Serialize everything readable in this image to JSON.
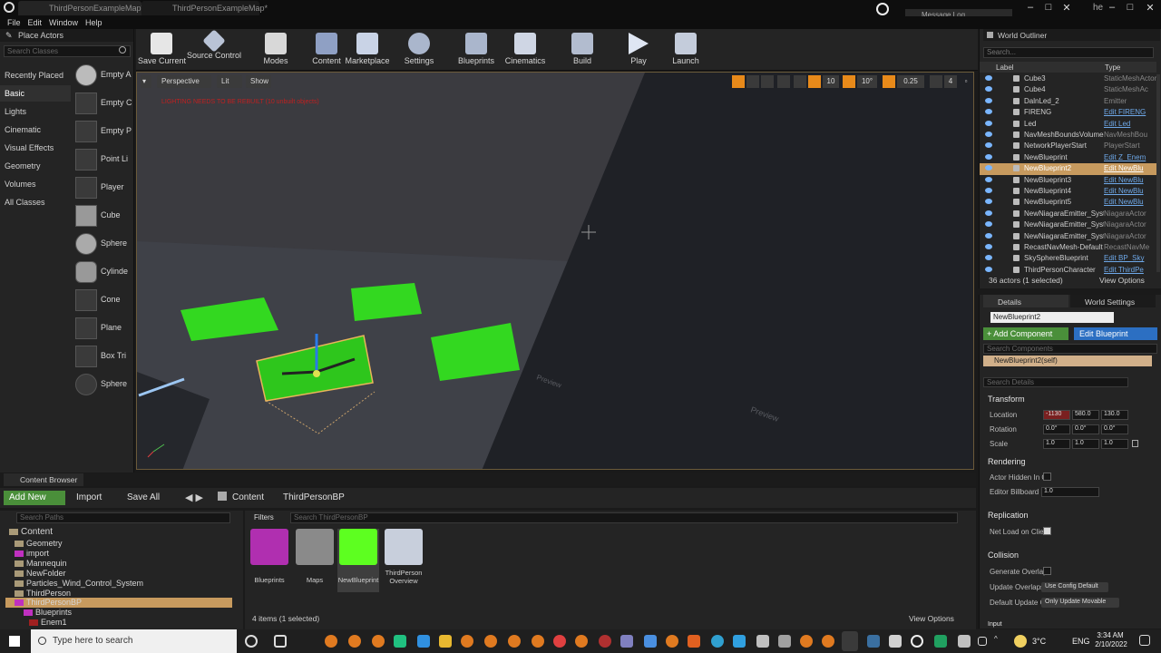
{
  "window": {
    "tabs": [
      "ThirdPersonExampleMap*",
      "ThirdPersonExampleMap*"
    ],
    "message_log": "Message Log",
    "user_initial": "he"
  },
  "menu": [
    "File",
    "Edit",
    "Window",
    "Help"
  ],
  "place_actors": {
    "title": "Place Actors",
    "search_placeholder": "Search Classes",
    "categories": [
      "Recently Placed",
      "Basic",
      "Lights",
      "Cinematic",
      "Visual Effects",
      "Geometry",
      "Volumes",
      "All Classes"
    ],
    "selected_category": "Basic",
    "items": [
      "Empty A",
      "Empty C",
      "Empty P",
      "Point Li",
      "Player",
      "Cube",
      "Sphere",
      "Cylinde",
      "Cone",
      "Plane",
      "Box Tri",
      "Sphere"
    ]
  },
  "toolbar": [
    {
      "label": "Save Current",
      "icon": "save-icon"
    },
    {
      "label": "Source Control",
      "icon": "source-control-icon"
    },
    {
      "label": "Modes",
      "icon": "modes-icon"
    },
    {
      "label": "Content",
      "icon": "content-icon"
    },
    {
      "label": "Marketplace",
      "icon": "marketplace-icon"
    },
    {
      "label": "Settings",
      "icon": "settings-icon"
    },
    {
      "label": "Blueprints",
      "icon": "blueprints-icon"
    },
    {
      "label": "Cinematics",
      "icon": "cinematics-icon"
    },
    {
      "label": "Build",
      "icon": "build-icon"
    },
    {
      "label": "Play",
      "icon": "play-icon"
    },
    {
      "label": "Launch",
      "icon": "launch-icon"
    }
  ],
  "viewport": {
    "perspective": "Perspective",
    "lit": "Lit",
    "show": "Show",
    "warning": "LIGHTING NEEDS TO BE REBUILT (10 unbuilt objects)",
    "grid_snap": "10",
    "rotation_snap": "10°",
    "scale_snap": "0.25",
    "camera_speed": "4",
    "preview_text": "Preview"
  },
  "outliner": {
    "title": "World Outliner",
    "search_placeholder": "Search...",
    "col_label": "Label",
    "col_type": "Type",
    "rows": [
      {
        "name": "Cube3",
        "type": "StaticMeshActor",
        "link": false
      },
      {
        "name": "Cube4",
        "type": "StaticMeshAc",
        "link": false
      },
      {
        "name": "DalnLed_2",
        "type": "Emitter",
        "link": false
      },
      {
        "name": "FIRENG",
        "type": "Edit FIRENG",
        "link": true
      },
      {
        "name": "Led",
        "type": "Edit Led",
        "link": true
      },
      {
        "name": "NavMeshBoundsVolume",
        "type": "NavMeshBou",
        "link": false
      },
      {
        "name": "NetworkPlayerStart",
        "type": "PlayerStart",
        "link": false
      },
      {
        "name": "NewBlueprint",
        "type": "Edit Z_Enem",
        "link": true
      },
      {
        "name": "NewBlueprint2",
        "type": "Edit NewBlu",
        "link": true,
        "selected": true
      },
      {
        "name": "NewBlueprint3",
        "type": "Edit NewBlu",
        "link": true
      },
      {
        "name": "NewBlueprint4",
        "type": "Edit NewBlu",
        "link": true
      },
      {
        "name": "NewBlueprint5",
        "type": "Edit NewBlu",
        "link": true
      },
      {
        "name": "NewNiagaraEmitter_System",
        "type": "NiagaraActor",
        "link": false
      },
      {
        "name": "NewNiagaraEmitter_System",
        "type": "NiagaraActor",
        "link": false
      },
      {
        "name": "NewNiagaraEmitter_System",
        "type": "NiagaraActor",
        "link": false
      },
      {
        "name": "RecastNavMesh-Default",
        "type": "RecastNavMe",
        "link": false
      },
      {
        "name": "SkySphereBlueprint",
        "type": "Edit BP_Sky",
        "link": true
      },
      {
        "name": "ThirdPersonCharacter",
        "type": "Edit ThirdPe",
        "link": true
      }
    ],
    "status": "36 actors (1 selected)",
    "view_options": "View Options"
  },
  "details": {
    "tab_details": "Details",
    "tab_world": "World Settings",
    "actor_name": "NewBlueprint2",
    "add_component": "+ Add Component",
    "edit_blueprint": "Edit Blueprint",
    "search_components": "Search Components",
    "self_component": "NewBlueprint2(self)",
    "search_details": "Search Details",
    "transform": "Transform",
    "location_label": "Location",
    "location": [
      "-1130",
      "580.0",
      "130.0"
    ],
    "rotation_label": "Rotation",
    "rotation": [
      "0.0°",
      "0.0°",
      "0.0°"
    ],
    "scale_label": "Scale",
    "scale": [
      "1.0",
      "1.0",
      "1.0"
    ],
    "rendering": "Rendering",
    "actor_hidden": "Actor Hidden In G",
    "editor_billboard": "Editor Billboard S",
    "billboard_value": "1.0",
    "replication": "Replication",
    "net_load": "Net Load on Clie",
    "collision": "Collision",
    "gen_overlap": "Generate Overlap",
    "update_overlaps": "Update Overlaps",
    "update_overlaps_value": "Use Config Default",
    "default_update": "Default Update C",
    "default_update_value": "Only Update Movable",
    "input": "Input"
  },
  "content_browser": {
    "tab": "Content Browser",
    "add_new": "Add New",
    "import": "Import",
    "save_all": "Save All",
    "breadcrumb": [
      "Content",
      "ThirdPersonBP"
    ],
    "search_paths": "Search Paths",
    "filters": "Filters",
    "search_assets": "Search ThirdPersonBP",
    "tree": [
      {
        "label": "Content",
        "depth": 0
      },
      {
        "label": "Geometry",
        "depth": 1
      },
      {
        "label": "import",
        "depth": 1
      },
      {
        "label": "Mannequin",
        "depth": 1
      },
      {
        "label": "NewFolder",
        "depth": 1
      },
      {
        "label": "Particles_Wind_Control_System",
        "depth": 1
      },
      {
        "label": "ThirdPerson",
        "depth": 1
      },
      {
        "label": "ThirdPersonBP",
        "depth": 1
      },
      {
        "label": "Blueprints",
        "depth": 2
      },
      {
        "label": "Enem1",
        "depth": 3
      }
    ],
    "assets": [
      "Blueprints",
      "Maps",
      "NewBlueprint",
      "ThirdPerson Overview"
    ],
    "status": "4 items (1 selected)",
    "view_options": "View Options"
  },
  "taskbar": {
    "search_placeholder": "Type here to search",
    "temperature": "3°C",
    "language": "ENG",
    "time": "3:34 AM",
    "date": "2/10/2022"
  }
}
